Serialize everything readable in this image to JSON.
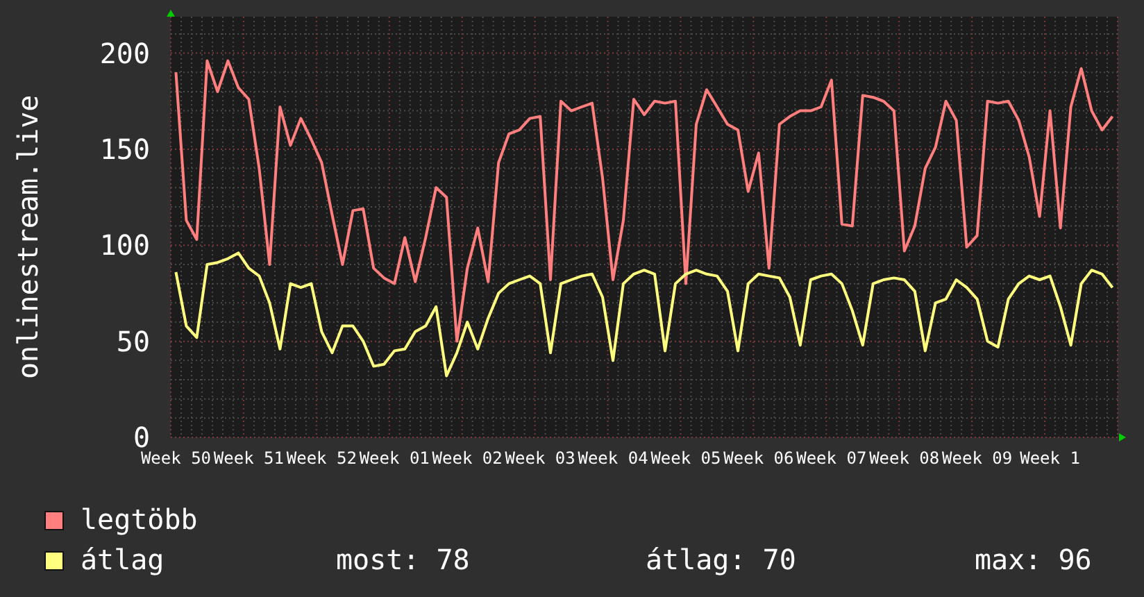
{
  "chart": {
    "chart_data": {
      "type": "line",
      "ylabel": "onlinestream.live",
      "grid": true,
      "ylim": [
        0,
        219
      ],
      "yticks": [
        0,
        50,
        100,
        150,
        200
      ],
      "categories": [
        "Week 50",
        null,
        null,
        null,
        null,
        null,
        null,
        "Week 51",
        null,
        null,
        null,
        null,
        null,
        null,
        "Week 52",
        null,
        null,
        null,
        null,
        null,
        null,
        "Week 01",
        null,
        null,
        null,
        null,
        null,
        null,
        "Week 02",
        null,
        null,
        null,
        null,
        null,
        null,
        "Week 03",
        null,
        null,
        null,
        null,
        null,
        null,
        "Week 04",
        null,
        null,
        null,
        null,
        null,
        null,
        "Week 05",
        null,
        null,
        null,
        null,
        null,
        null,
        "Week 06",
        null,
        null,
        null,
        null,
        null,
        null,
        "Week 07",
        null,
        null,
        null,
        null,
        null,
        null,
        "Week 08",
        null,
        null,
        null,
        null,
        null,
        null,
        "Week 09",
        null,
        null,
        null,
        null,
        null,
        null,
        "Week 1",
        null,
        null,
        null,
        null,
        null,
        null
      ],
      "series": [
        {
          "name": "legtöbb",
          "color": "#ff7f7f",
          "values": [
            190,
            113,
            103,
            196,
            180,
            196,
            182,
            176,
            140,
            90,
            172,
            152,
            166,
            155,
            143,
            116,
            90,
            118,
            119,
            88,
            83,
            80,
            104,
            81,
            104,
            130,
            125,
            50,
            88,
            109,
            81,
            143,
            158,
            160,
            166,
            167,
            82,
            175,
            170,
            172,
            174,
            135,
            82,
            113,
            176,
            168,
            175,
            174,
            175,
            80,
            163,
            181,
            172,
            163,
            160,
            128,
            148,
            88,
            163,
            167,
            170,
            170,
            172,
            186,
            111,
            110,
            178,
            177,
            175,
            170,
            97,
            110,
            140,
            151,
            175,
            165,
            99,
            105,
            175,
            174,
            175,
            165,
            146,
            115,
            170,
            109,
            172,
            192,
            170,
            160,
            167
          ]
        },
        {
          "name": "átlag",
          "color": "#ffff7f",
          "values": [
            86,
            58,
            52,
            90,
            91,
            93,
            96,
            88,
            84,
            70,
            46,
            80,
            78,
            80,
            55,
            44,
            58,
            58,
            50,
            37,
            38,
            45,
            46,
            55,
            58,
            68,
            32,
            44,
            60,
            46,
            62,
            75,
            80,
            82,
            84,
            80,
            44,
            80,
            82,
            84,
            85,
            73,
            40,
            80,
            85,
            87,
            85,
            45,
            80,
            85,
            87,
            85,
            84,
            76,
            45,
            80,
            85,
            84,
            83,
            73,
            48,
            82,
            84,
            85,
            80,
            66,
            48,
            80,
            82,
            83,
            82,
            76,
            45,
            70,
            72,
            82,
            78,
            72,
            50,
            47,
            72,
            80,
            84,
            82,
            84,
            68,
            48,
            80,
            87,
            85,
            78
          ]
        }
      ]
    }
  },
  "legend_stats": [
    "most: 78",
    "átlag: 70",
    "max: 96"
  ]
}
